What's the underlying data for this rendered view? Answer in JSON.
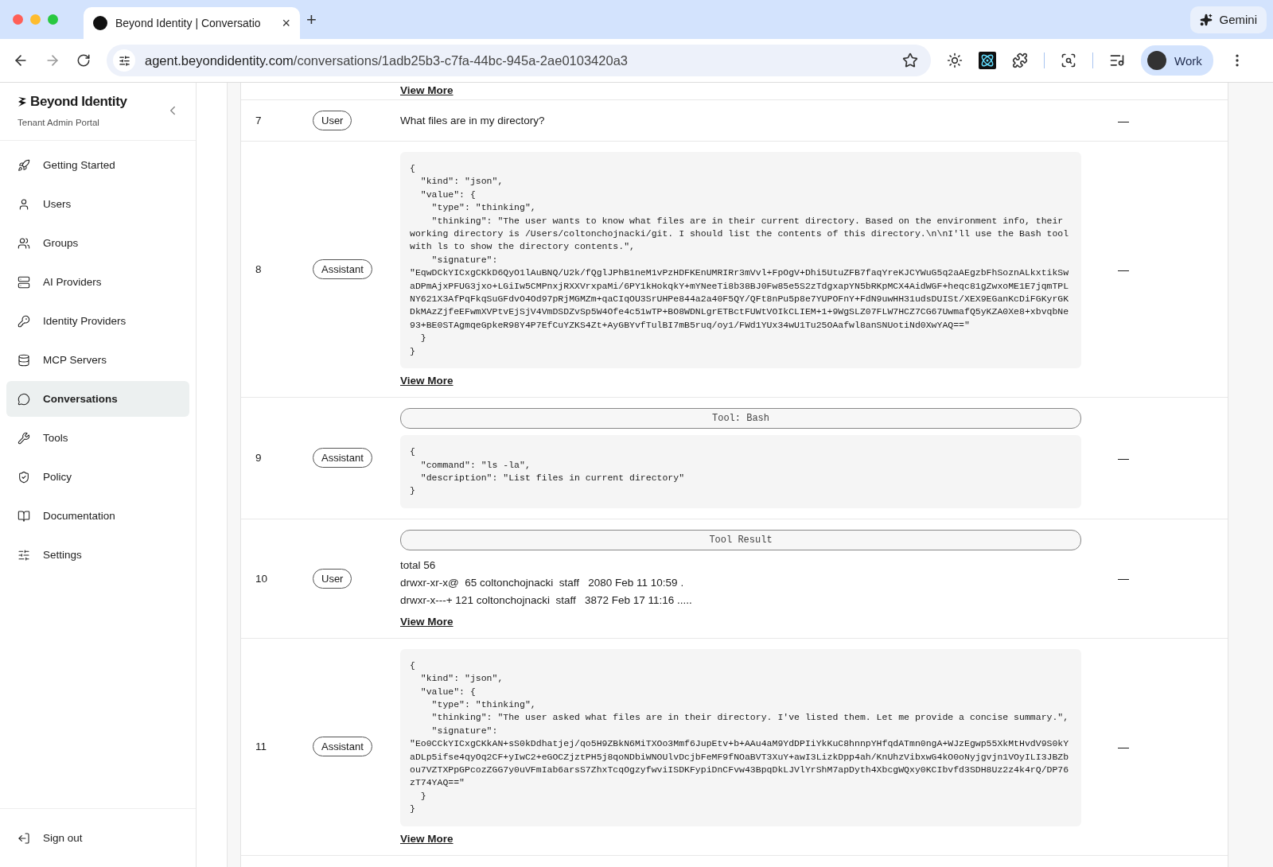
{
  "browser": {
    "tab": {
      "title": "Beyond Identity | Conversatio",
      "close": "×"
    },
    "new_tab": "+",
    "gemini": "Gemini",
    "url": {
      "host": "agent.beyondidentity.com",
      "path": "/conversations/1adb25b3-c7fa-44bc-945a-2ae0103420a3"
    },
    "profile": "Work"
  },
  "sidebar": {
    "brand": "Beyond Identity",
    "subtitle": "Tenant Admin Portal",
    "items": [
      {
        "label": "Getting Started",
        "selected": false
      },
      {
        "label": "Users",
        "selected": false
      },
      {
        "label": "Groups",
        "selected": false
      },
      {
        "label": "AI Providers",
        "selected": false
      },
      {
        "label": "Identity Providers",
        "selected": false
      },
      {
        "label": "MCP Servers",
        "selected": false
      },
      {
        "label": "Conversations",
        "selected": true
      },
      {
        "label": "Tools",
        "selected": false
      },
      {
        "label": "Policy",
        "selected": false
      },
      {
        "label": "Documentation",
        "selected": false
      },
      {
        "label": "Settings",
        "selected": false
      }
    ],
    "sign_out": "Sign out"
  },
  "rows": [
    {
      "kind": "partial",
      "link": "View More"
    },
    {
      "kind": "text",
      "index": "7",
      "role": "User",
      "text": "What files are in my directory?",
      "column_4": "—"
    },
    {
      "kind": "code",
      "index": "8",
      "role": "Assistant",
      "column_4": "—",
      "link": "View More",
      "lines": [
        "{",
        "  \"kind\": \"json\",",
        "  \"value\": {",
        "    \"type\": \"thinking\",",
        "    \"thinking\": \"The user wants to know what files are in their current directory. Based on the environment info, their",
        "working directory is /Users/coltonchojnacki/git. I should list the contents of this directory.\\n\\nI'll use the Bash tool",
        "with ls to show the directory contents.\",",
        "    \"signature\":",
        "\"EqwDCkYICxgCKkD6QyO1lAuBNQ/U2k/fQglJPhB1neM1vPzHDFKEnUMRIRr3mVvl+FpOgV+Dhi5UtuZFB7faqYreKJCYWuG5q2aAEgzbFhSoznALkxtikSw",
        "aDPmAjxPFUG3jxo+LGiIw5CMPnxjRXXVrxpaMi/6PY1kHokqkY+mYNeeTi8b38BJ0Fw85e5S2zTdgxapYN5bRKpMCX4AidWGF+heqc81gZwxoME1E7jqmTPL",
        "NY621X3AfPqFkqSuGFdvO4Od97pRjMGMZm+qaCIqOU3SrUHPe844a2a40F5QY/QFt8nPu5p8e7YUPOFnY+FdN9uwHH31udsDUISt/XEX9EGanKcDiFGKyrGK",
        "DkMAzZjfeEFwmXVPtvEjSjV4VmDSDZvSp5W4Ofe4c51wTP+BO8WDNLgrETBctFUWtVOIkCLIEM+1+9WgSLZ07FLW7HCZ7CG67UwmafQ5yKZA0Xe8+xbvqbNe",
        "93+BE0STAgmqeGpkeR98Y4P7EfCuYZKS4Zt+AyGBYvfTulBI7mB5ruq/oy1/FWd1YUx34wU1Tu25OAafwl8anSNUotiNd0XwYAQ==\"",
        "  }",
        "}"
      ]
    },
    {
      "kind": "tool_call",
      "index": "9",
      "role": "Assistant",
      "column_4": "—",
      "tool": "Tool: Bash",
      "lines": [
        "{",
        "  \"command\": \"ls -la\",",
        "  \"description\": \"List files in current directory\"",
        "}"
      ]
    },
    {
      "kind": "tool_result",
      "index": "10",
      "role": "User",
      "column_4": "—",
      "tool": "Tool Result",
      "link": "View More",
      "lines": [
        "total 56",
        "drwxr-xr-x@  65 coltonchojnacki  staff   2080 Feb 11 10:59 .",
        "drwxr-x---+ 121 coltonchojnacki  staff   3872 Feb 17 11:16 ....."
      ]
    },
    {
      "kind": "code",
      "index": "11",
      "role": "Assistant",
      "column_4": "—",
      "link": "View More",
      "lines": [
        "{",
        "  \"kind\": \"json\",",
        "  \"value\": {",
        "    \"type\": \"thinking\",",
        "    \"thinking\": \"The user asked what files are in their directory. I've listed them. Let me provide a concise summary.\",",
        "    \"signature\":",
        "\"Eo0CCkYICxgCKkAN+sS0kDdhatjej/qo5H9ZBkN6MiTXOo3Mmf6JupEtv+b+AAu4aM9YdDPIiYkKuC8hnnpYHfqdATmn0ngA+WJzEgwp55XkMtHvdV9S0kY",
        "aDLp5ifse4qyOq2CF+yIwC2+eGOCZjztPH5j8qoNDbiWNOUlvDcjbFeMF9fNOaBVT3XuY+awI3LizkDpp4ah/KnUhzVibxwG4kO0oNyjgvjn1VOyILI3JBZb",
        "ou7VZTXPpGPcozZGG7y0uVFmIab6arsS7ZhxTcqOgzyfwviISDKFypiDnCFvw43BpqDkLJVlYrShM7apDyth4XbcgWQxy0KCIbvfd3SDH8Uz2z4k4rQ/DP76",
        "zT74YAQ==\"",
        "  }",
        "}"
      ]
    }
  ]
}
